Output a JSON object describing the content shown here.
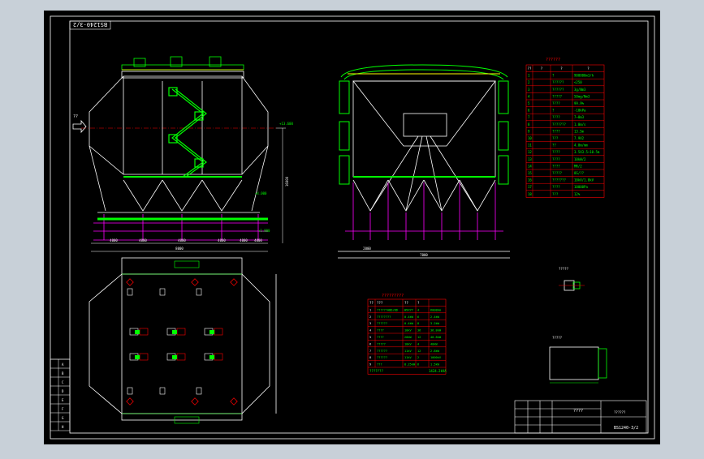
{
  "drawing": {
    "stamp_top_left": "BS1240-3/2",
    "title_block_code": "BS1240-3/2",
    "title_block_name": "??????",
    "title_block_center": "????",
    "inlet_arrow_label": "??",
    "colors": {
      "background": "#000000",
      "frame": "#ffffff",
      "structure": "#ffffff",
      "stairs": "#00ff00",
      "pipes": "#ff00ff",
      "tables": "#ff0000",
      "table_text": "#00ff00",
      "dim": "#00ff00",
      "viewport_bg": "#c8d0d8"
    }
  },
  "param_table": {
    "title": "??????",
    "headers": [
      "??",
      "?",
      "?",
      "?"
    ],
    "rows": [
      [
        "1",
        "?",
        "900000m3/h"
      ],
      [
        "2",
        "??????",
        "<250"
      ],
      [
        "3",
        "??????",
        "3g/Nm3"
      ],
      [
        "4",
        "?????",
        "50mg/Nm3"
      ],
      [
        "5",
        "????",
        "99.9%"
      ],
      [
        "6",
        "?",
        "-10kPa"
      ],
      [
        "7",
        "????",
        "7~8m3"
      ],
      [
        "8",
        "???????",
        "1.0m/s"
      ],
      [
        "9",
        "????",
        "13.5m"
      ],
      [
        "10",
        "???",
        "7.9V2"
      ],
      [
        "11",
        "??",
        "4.8m/mm"
      ],
      [
        "12",
        "????",
        "3.5X3.5~10.5m"
      ],
      [
        "13",
        "????",
        "10kW/2"
      ],
      [
        "14",
        "????",
        "MR/2"
      ],
      [
        "15",
        "?????",
        "8S/??"
      ],
      [
        "16",
        "???????",
        "10kV/1.0kV"
      ],
      [
        "17",
        "????",
        "10000Pa"
      ],
      [
        "18",
        "???",
        "12%"
      ]
    ]
  },
  "equip_table": {
    "title": "?????????",
    "headers": [
      "??",
      "???",
      "??",
      "?"
    ],
    "rows": [
      [
        "1",
        "??????ABD/BD",
        "W9XYY",
        "4",
        "6008AA"
      ],
      [
        "2",
        "????????",
        "0.4kW",
        "6",
        "2.4kW"
      ],
      [
        "3",
        "??????",
        "0.4kW",
        "8",
        "3.2kW"
      ],
      [
        "4",
        "????",
        "10kV",
        "36",
        "36.8kW"
      ],
      [
        "5",
        "????",
        "20kW",
        "12",
        "40.8kW"
      ],
      [
        "6",
        "?????",
        "10kV",
        "4",
        "40kW"
      ],
      [
        "7",
        "??????",
        "11kV",
        "12",
        "2.8kW"
      ],
      [
        "8",
        "??????",
        "11kV",
        "2",
        "1000kV"
      ],
      [
        "9",
        "???",
        "8.25kW",
        "6",
        "1.5kW"
      ]
    ],
    "footer_label": "???????",
    "footer_value": "1424.2kVA"
  },
  "detail_labels": {
    "small_detail": "?????",
    "section_detail": "?????"
  },
  "dimensions": {
    "front_width": "8000",
    "front_bay_1": "4000",
    "front_bay_2": "4000",
    "front_bay_3": "4000",
    "front_bay_4": "4000",
    "front_bay_5": "4000",
    "front_bay_6": "4000",
    "side_width": "7000",
    "side_inner": "2000",
    "height_total": "16000",
    "elev_top": "+13.600",
    "elev_mid": "+4.000",
    "elev_low": "+1.800"
  },
  "revision_block_rows": [
    "A",
    "B",
    "C",
    "D",
    "E",
    "F",
    "G",
    "H"
  ]
}
